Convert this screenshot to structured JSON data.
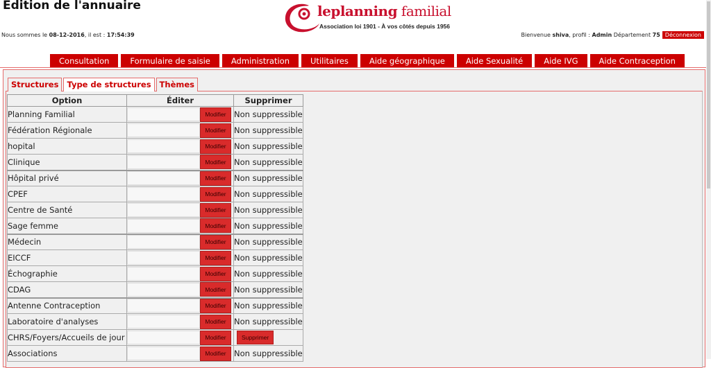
{
  "header": {
    "title": "Édition de l'annuaire",
    "date_prefix": "Nous sommes le ",
    "date": "08-12-2016",
    "time_prefix": ", il est : ",
    "time": "17:54:39",
    "logo": {
      "brand_le": "le",
      "brand_planning": "planning",
      "brand_familial": " familial",
      "tagline": "Association loi 1901 - À vos côtés depuis 1956",
      "color": "#c8102e"
    },
    "user": {
      "welcome": "Bienvenue ",
      "username": "shiva",
      "profile_prefix": ", profil : ",
      "profile": "Admin",
      "dept_prefix": " Département ",
      "department": "75",
      "logout_label": "Déconnexion"
    }
  },
  "nav": {
    "accent": "#cc0000",
    "items": [
      {
        "label": "Consultation"
      },
      {
        "label": "Formulaire de saisie"
      },
      {
        "label": "Administration"
      },
      {
        "label": "Utilitaires"
      },
      {
        "label": "Aide géographique"
      },
      {
        "label": "Aide Sexualité"
      },
      {
        "label": "Aide IVG"
      },
      {
        "label": "Aide Contraception"
      }
    ]
  },
  "subtabs": {
    "items": [
      {
        "label": "Structures",
        "active": false
      },
      {
        "label": "Type de structures",
        "active": true
      },
      {
        "label": "Thèmes",
        "active": false
      }
    ]
  },
  "table": {
    "headers": {
      "option": "Option",
      "edit": "Éditer",
      "delete": "Supprimer"
    },
    "modify_label": "Modifier",
    "rows": [
      {
        "option": "Planning Familial",
        "edit_value": "",
        "delete": "Non suppressible",
        "deletable": false
      },
      {
        "option": "Fédération Régionale",
        "edit_value": "",
        "delete": "Non suppressible",
        "deletable": false
      },
      {
        "option": "hopital",
        "edit_value": "",
        "delete": "Non suppressible",
        "deletable": false
      },
      {
        "option": "Clinique",
        "edit_value": "",
        "delete": "Non suppressible",
        "deletable": false
      },
      {
        "option": "Hôpital privé",
        "edit_value": "",
        "delete": "Non suppressible",
        "deletable": false
      },
      {
        "option": "CPEF",
        "edit_value": "",
        "delete": "Non suppressible",
        "deletable": false
      },
      {
        "option": "Centre de Santé",
        "edit_value": "",
        "delete": "Non suppressible",
        "deletable": false
      },
      {
        "option": "Sage femme",
        "edit_value": "",
        "delete": "Non suppressible",
        "deletable": false
      },
      {
        "option": "Médecin",
        "edit_value": "",
        "delete": "Non suppressible",
        "deletable": false
      },
      {
        "option": "EICCF",
        "edit_value": "",
        "delete": "Non suppressible",
        "deletable": false
      },
      {
        "option": "Échographie",
        "edit_value": "",
        "delete": "Non suppressible",
        "deletable": false
      },
      {
        "option": "CDAG",
        "edit_value": "",
        "delete": "Non suppressible",
        "deletable": false
      },
      {
        "option": "Antenne Contraception",
        "edit_value": "",
        "delete": "Non suppressible",
        "deletable": false
      },
      {
        "option": "Laboratoire d'analyses",
        "edit_value": "",
        "delete": "Non suppressible",
        "deletable": false
      },
      {
        "option": "CHRS/Foyers/Accueils de jour",
        "edit_value": "",
        "delete": "Supprimer",
        "deletable": true
      },
      {
        "option": "Associations",
        "edit_value": "",
        "delete": "Non suppressible",
        "deletable": false
      }
    ]
  }
}
